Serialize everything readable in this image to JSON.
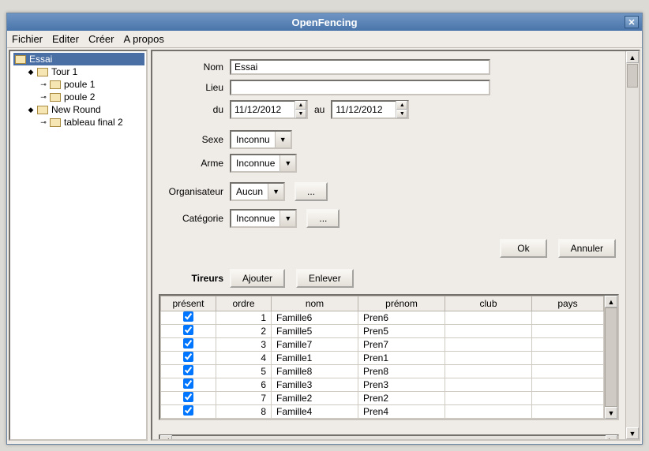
{
  "window": {
    "title": "OpenFencing"
  },
  "menu": {
    "file": "Fichier",
    "edit": "Editer",
    "create": "Créer",
    "about": "A propos"
  },
  "tree": {
    "root": "Essai",
    "tour1": "Tour 1",
    "poule1": "poule 1",
    "poule2": "poule 2",
    "newround": "New Round",
    "tableau": "tableau final 2"
  },
  "form": {
    "labels": {
      "nom": "Nom",
      "lieu": "Lieu",
      "du": "du",
      "au": "au",
      "sexe": "Sexe",
      "arme": "Arme",
      "org": "Organisateur",
      "cat": "Catégorie",
      "tireurs": "Tireurs"
    },
    "values": {
      "nom": "Essai",
      "lieu": "",
      "date_from": "11/12/2012",
      "date_to": "11/12/2012",
      "sexe": "Inconnu",
      "arme": "Inconnue",
      "org": "Aucun",
      "cat": "Inconnue"
    },
    "buttons": {
      "more": "...",
      "ok": "Ok",
      "cancel": "Annuler",
      "add": "Ajouter",
      "remove": "Enlever"
    }
  },
  "table": {
    "headers": {
      "present": "présent",
      "ordre": "ordre",
      "nom": "nom",
      "prenom": "prénom",
      "club": "club",
      "pays": "pays"
    },
    "rows": [
      {
        "present": true,
        "ordre": "1",
        "nom": "Famille6",
        "prenom": "Pren6",
        "club": "",
        "pays": ""
      },
      {
        "present": true,
        "ordre": "2",
        "nom": "Famille5",
        "prenom": "Pren5",
        "club": "",
        "pays": ""
      },
      {
        "present": true,
        "ordre": "3",
        "nom": "Famille7",
        "prenom": "Pren7",
        "club": "",
        "pays": ""
      },
      {
        "present": true,
        "ordre": "4",
        "nom": "Famille1",
        "prenom": "Pren1",
        "club": "",
        "pays": ""
      },
      {
        "present": true,
        "ordre": "5",
        "nom": "Famille8",
        "prenom": "Pren8",
        "club": "",
        "pays": ""
      },
      {
        "present": true,
        "ordre": "6",
        "nom": "Famille3",
        "prenom": "Pren3",
        "club": "",
        "pays": ""
      },
      {
        "present": true,
        "ordre": "7",
        "nom": "Famille2",
        "prenom": "Pren2",
        "club": "",
        "pays": ""
      },
      {
        "present": true,
        "ordre": "8",
        "nom": "Famille4",
        "prenom": "Pren4",
        "club": "",
        "pays": ""
      }
    ]
  }
}
